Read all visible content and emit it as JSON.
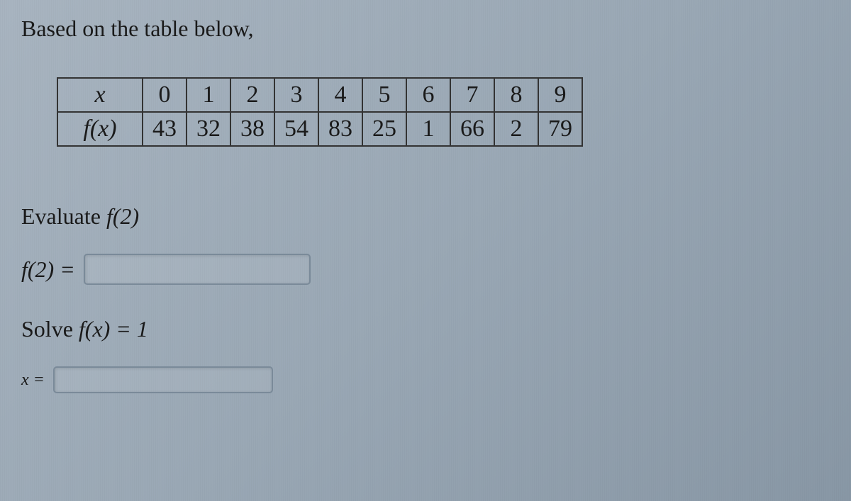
{
  "intro": "Based on the table below,",
  "table": {
    "row1_header": "x",
    "row1_values": [
      "0",
      "1",
      "2",
      "3",
      "4",
      "5",
      "6",
      "7",
      "8",
      "9"
    ],
    "row2_header": "f(x)",
    "row2_values": [
      "43",
      "32",
      "38",
      "54",
      "83",
      "25",
      "1",
      "66",
      "2",
      "79"
    ]
  },
  "q1": {
    "prompt_prefix": "Evaluate ",
    "prompt_math": "f(2)",
    "label_math": "f(2) ="
  },
  "q2": {
    "prompt_prefix": "Solve ",
    "prompt_math": "f(x) = 1",
    "label_math": "x ="
  },
  "chart_data": {
    "type": "table",
    "title": "Based on the table below,",
    "x": [
      0,
      1,
      2,
      3,
      4,
      5,
      6,
      7,
      8,
      9
    ],
    "f_of_x": [
      43,
      32,
      38,
      54,
      83,
      25,
      1,
      66,
      2,
      79
    ]
  }
}
